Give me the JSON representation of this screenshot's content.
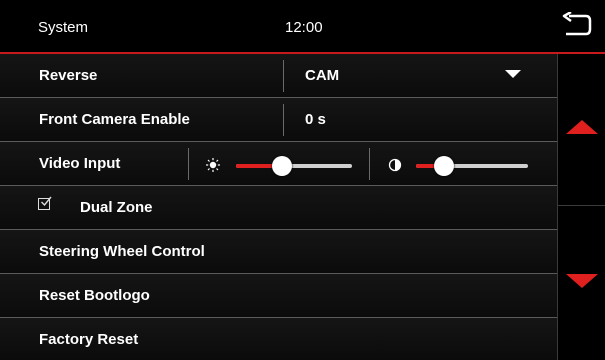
{
  "header": {
    "title": "System",
    "clock": "12:00",
    "back_icon": "back-arrow-icon"
  },
  "rows": {
    "reverse": {
      "label": "Reverse",
      "value": "CAM",
      "dropdown_icon": "dropdown-triangle-icon"
    },
    "front_camera": {
      "label": "Front Camera Enable",
      "value": "0 s"
    },
    "video_input": {
      "label": "Video Input",
      "brightness_icon": "sun-icon",
      "brightness_level": 0.4,
      "contrast_icon": "contrast-icon",
      "contrast_level": 0.25
    },
    "dual_zone": {
      "label": "Dual Zone",
      "checked": true,
      "check_icon": "checkbox-checked-icon"
    },
    "steering": {
      "label": "Steering Wheel Control"
    },
    "reset_bootlogo": {
      "label": "Reset Bootlogo"
    },
    "factory_reset": {
      "label": "Factory Reset"
    }
  },
  "scroll": {
    "up_icon": "scroll-up-arrow-icon",
    "down_icon": "scroll-down-arrow-icon"
  },
  "colors": {
    "accent": "#e0201f",
    "background": "#000000",
    "row_separator": "#5a5a5a"
  }
}
